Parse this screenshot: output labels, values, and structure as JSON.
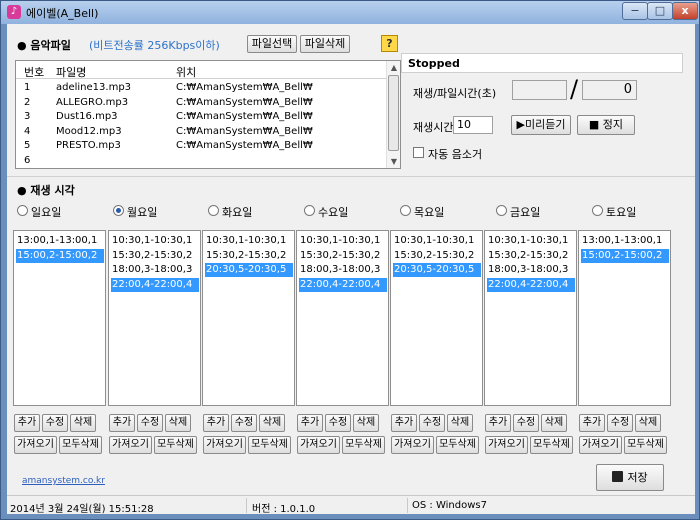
{
  "window": {
    "title": "에이벨(A_Bell)",
    "min": "−",
    "max": "□",
    "close": "x"
  },
  "music": {
    "title": "● 음악파일",
    "subtitle": "(비트전송률 256Kbps이하)",
    "btn_select": "파일선택",
    "btn_delete": "파일삭제",
    "help": "?",
    "headers": {
      "num": "번호",
      "name": "파일명",
      "loc": "위치"
    },
    "files": [
      {
        "num": "1",
        "name": "adeline13.mp3",
        "loc": "C:₩AmanSystem₩A_Bell₩"
      },
      {
        "num": "2",
        "name": "ALLEGRO.mp3",
        "loc": "C:₩AmanSystem₩A_Bell₩"
      },
      {
        "num": "3",
        "name": "Dust16.mp3",
        "loc": "C:₩AmanSystem₩A_Bell₩"
      },
      {
        "num": "4",
        "name": "Mood12.mp3",
        "loc": "C:₩AmanSystem₩A_Bell₩"
      },
      {
        "num": "5",
        "name": "PRESTO.mp3",
        "loc": "C:₩AmanSystem₩A_Bell₩"
      },
      {
        "num": "6",
        "name": "",
        "loc": ""
      }
    ]
  },
  "player": {
    "status": "Stopped",
    "playtime_label": "재생/파일시간(초)",
    "slash": "/",
    "total_time": "0",
    "playsec_label": "재생시간",
    "playsec_value": "10",
    "preview_label": "▶미리듣기",
    "stop_label": "■ 정지",
    "autofade_label": "자동 음소거"
  },
  "schedule": {
    "title": "● 재생 시각",
    "days": [
      {
        "label": "일요일",
        "selected": false,
        "entries": [
          {
            "text": "13:00,1-13:00,1",
            "sel": false
          },
          {
            "text": "15:00,2-15:00,2",
            "sel": true
          }
        ]
      },
      {
        "label": "월요일",
        "selected": true,
        "entries": [
          {
            "text": "10:30,1-10:30,1",
            "sel": false
          },
          {
            "text": "15:30,2-15:30,2",
            "sel": false
          },
          {
            "text": "18:00,3-18:00,3",
            "sel": false
          },
          {
            "text": "22:00,4-22:00,4",
            "sel": true
          }
        ]
      },
      {
        "label": "화요일",
        "selected": false,
        "entries": [
          {
            "text": "10:30,1-10:30,1",
            "sel": false
          },
          {
            "text": "15:30,2-15:30,2",
            "sel": false
          },
          {
            "text": "20:30,5-20:30,5",
            "sel": true
          }
        ]
      },
      {
        "label": "수요일",
        "selected": false,
        "entries": [
          {
            "text": "10:30,1-10:30,1",
            "sel": false
          },
          {
            "text": "15:30,2-15:30,2",
            "sel": false
          },
          {
            "text": "18:00,3-18:00,3",
            "sel": false
          },
          {
            "text": "22:00,4-22:00,4",
            "sel": true
          }
        ]
      },
      {
        "label": "목요일",
        "selected": false,
        "entries": [
          {
            "text": "10:30,1-10:30,1",
            "sel": false
          },
          {
            "text": "15:30,2-15:30,2",
            "sel": false
          },
          {
            "text": "20:30,5-20:30,5",
            "sel": true
          }
        ]
      },
      {
        "label": "금요일",
        "selected": false,
        "entries": [
          {
            "text": "10:30,1-10:30,1",
            "sel": false
          },
          {
            "text": "15:30,2-15:30,2",
            "sel": false
          },
          {
            "text": "18:00,3-18:00,3",
            "sel": false
          },
          {
            "text": "22:00,4-22:00,4",
            "sel": true
          }
        ]
      },
      {
        "label": "토요일",
        "selected": false,
        "entries": [
          {
            "text": "13:00,1-13:00,1",
            "sel": false
          },
          {
            "text": "15:00,2-15:00,2",
            "sel": true
          }
        ]
      }
    ],
    "btn_add": "추가",
    "btn_edit": "수정",
    "btn_del": "삭제",
    "btn_import": "가져오기",
    "btn_delall": "모두삭제"
  },
  "footer": {
    "link": "amansystem.co.kr",
    "save_label": "저장"
  },
  "statusbar": {
    "date": "2014년 3월 24일(월) 15:51:28",
    "version": "버전 : 1.0.1.0",
    "os": "OS : Windows7"
  }
}
